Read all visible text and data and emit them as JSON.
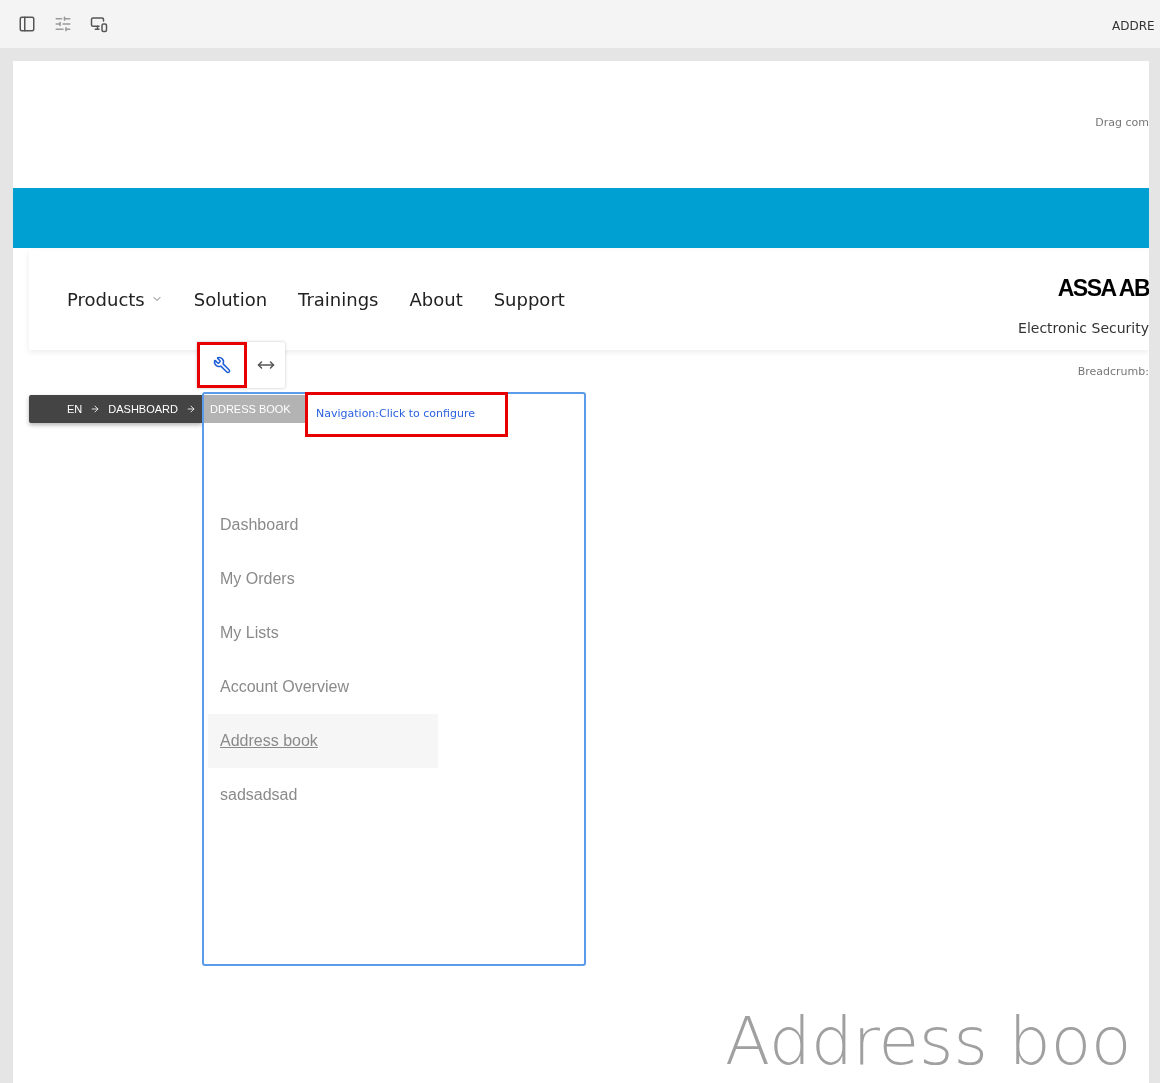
{
  "toolbar": {
    "page_title": "ADDRE"
  },
  "header": {
    "drop_hint": "Drag com"
  },
  "nav": {
    "items": [
      {
        "label": "Products",
        "dropdown": true
      },
      {
        "label": "Solution",
        "dropdown": false
      },
      {
        "label": "Trainings",
        "dropdown": false
      },
      {
        "label": "About",
        "dropdown": false
      },
      {
        "label": "Support",
        "dropdown": false
      }
    ],
    "logo": "ASSA AB",
    "tagline": "Electronic Security"
  },
  "breadcrumb_hint": "Breadcrumb:",
  "breadcrumb": {
    "items": [
      "EN",
      "DASHBOARD"
    ],
    "current": "DDRESS BOOK"
  },
  "navigation_panel": {
    "configure_label": "Navigation:Click to configure",
    "items": [
      {
        "label": "Dashboard",
        "selected": false
      },
      {
        "label": "My Orders",
        "selected": false
      },
      {
        "label": "My Lists",
        "selected": false
      },
      {
        "label": "Account Overview",
        "selected": false
      },
      {
        "label": "Address book",
        "selected": true
      },
      {
        "label": "sadsadsad",
        "selected": false
      }
    ]
  },
  "page_heading": "Address boo"
}
